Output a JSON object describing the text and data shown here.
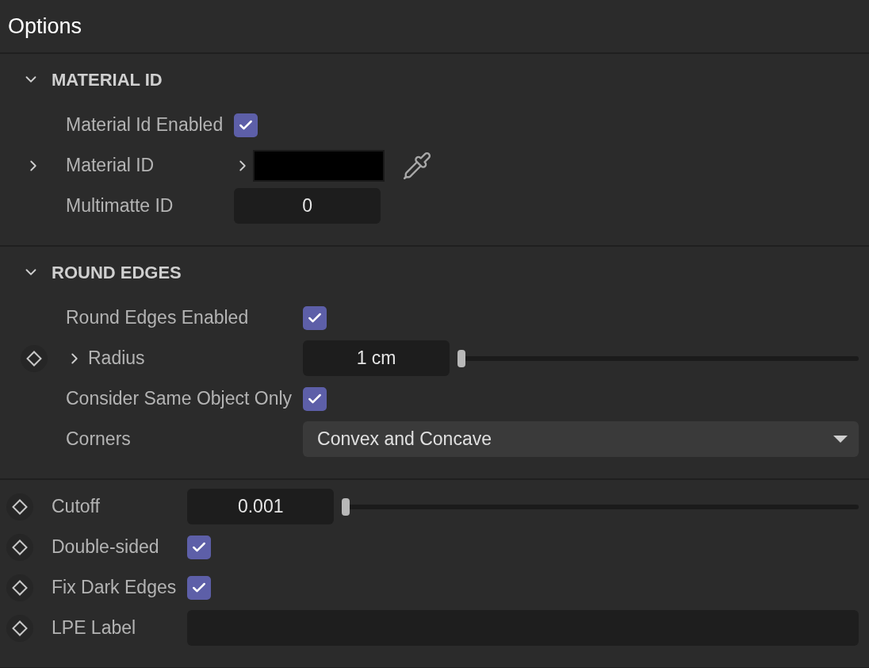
{
  "title": "Options",
  "sections": [
    {
      "title": "MATERIAL ID",
      "expanded": true,
      "rows": [
        {
          "kind": "checkbox",
          "label": "Material Id Enabled",
          "checked": true,
          "keyframe": false
        },
        {
          "kind": "color",
          "label": "Material ID",
          "expanded": false,
          "keyframe": false
        },
        {
          "kind": "number",
          "label": "Multimatte ID",
          "value": "0",
          "keyframe": false
        }
      ]
    },
    {
      "title": "ROUND EDGES",
      "expanded": true,
      "rows": [
        {
          "kind": "checkbox",
          "label": "Round Edges Enabled",
          "checked": true,
          "keyframe": false
        },
        {
          "kind": "slider",
          "label": "Radius",
          "value": "1 cm",
          "expanded": false,
          "keyframe": true
        },
        {
          "kind": "checkbox",
          "label": "Consider Same Object Only",
          "checked": true,
          "keyframe": false
        },
        {
          "kind": "dropdown",
          "label": "Corners",
          "value": "Convex and Concave",
          "keyframe": false
        }
      ]
    },
    {
      "rows": [
        {
          "kind": "slider",
          "label": "Cutoff",
          "value": "0.001",
          "keyframe": true
        },
        {
          "kind": "checkbox",
          "label": "Double-sided",
          "checked": true,
          "keyframe": true
        },
        {
          "kind": "checkbox",
          "label": "Fix Dark Edges",
          "checked": true,
          "keyframe": true
        },
        {
          "kind": "text",
          "label": "LPE Label",
          "keyframe": true
        }
      ]
    }
  ]
}
